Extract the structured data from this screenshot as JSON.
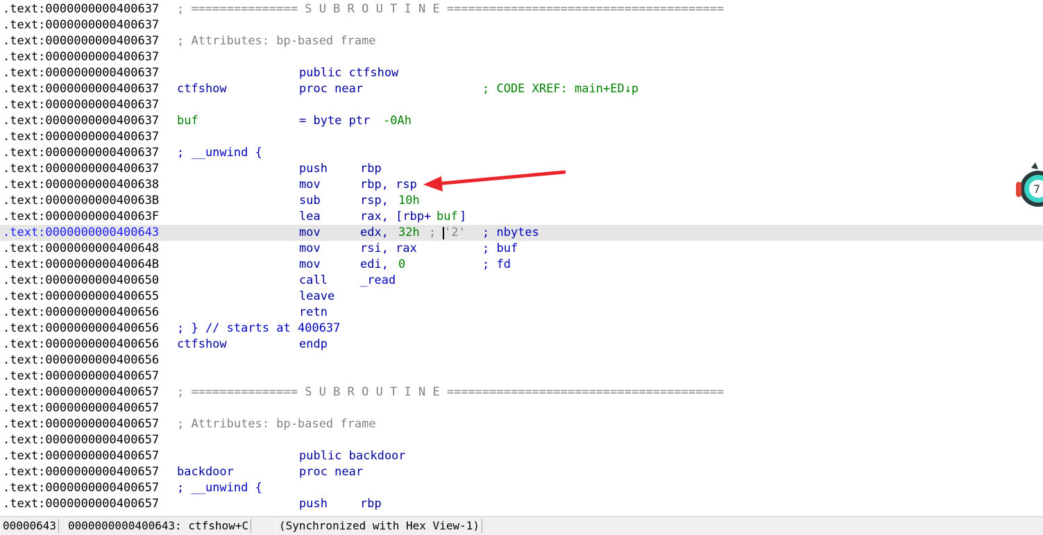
{
  "listing": {
    "lines": [
      {
        "addr": ".text:0000000000400637",
        "parts": [
          {
            "t": "; =============== S U B R O U T I N E =======================================",
            "c": "c-gray",
            "col": 255
          }
        ]
      },
      {
        "addr": ".text:0000000000400637",
        "parts": []
      },
      {
        "addr": ".text:0000000000400637",
        "parts": [
          {
            "t": "; Attributes: bp-based frame",
            "c": "c-gray",
            "col": 255
          }
        ]
      },
      {
        "addr": ".text:0000000000400637",
        "parts": []
      },
      {
        "addr": ".text:0000000000400637",
        "parts": [
          {
            "t": "public ctfshow",
            "c": "c-navy",
            "col": 431
          }
        ]
      },
      {
        "addr": ".text:0000000000400637",
        "parts": [
          {
            "t": "ctfshow",
            "c": "c-navy",
            "col": 255
          },
          {
            "t": "proc near",
            "c": "c-navy",
            "col": 431
          },
          {
            "t": "; CODE XREF: main+ED↓p",
            "c": "c-green",
            "col": 695
          }
        ]
      },
      {
        "addr": ".text:0000000000400637",
        "parts": []
      },
      {
        "addr": ".text:0000000000400637",
        "parts": [
          {
            "t": "buf",
            "c": "c-green",
            "col": 255
          },
          {
            "t": "= byte ptr ",
            "c": "c-navy",
            "col": 431
          },
          {
            "t": "-0Ah",
            "c": "c-green",
            "col": 552
          }
        ]
      },
      {
        "addr": ".text:0000000000400637",
        "parts": []
      },
      {
        "addr": ".text:0000000000400637",
        "parts": [
          {
            "t": "; __unwind {",
            "c": "c-blue",
            "col": 255
          }
        ]
      },
      {
        "addr": ".text:0000000000400637",
        "parts": [
          {
            "t": "push",
            "c": "c-navy",
            "col": 431
          },
          {
            "t": "rbp",
            "c": "c-navy",
            "col": 519
          }
        ]
      },
      {
        "addr": ".text:0000000000400638",
        "parts": [
          {
            "t": "mov",
            "c": "c-navy",
            "col": 431
          },
          {
            "t": "rbp, rsp",
            "c": "c-navy",
            "col": 519
          }
        ]
      },
      {
        "addr": ".text:000000000040063B",
        "parts": [
          {
            "t": "sub",
            "c": "c-navy",
            "col": 431
          },
          {
            "t": "rsp, ",
            "c": "c-navy",
            "col": 519
          },
          {
            "t": "10h",
            "c": "c-green",
            "col": 574
          }
        ]
      },
      {
        "addr": ".text:000000000040063F",
        "parts": [
          {
            "t": "lea",
            "c": "c-navy",
            "col": 431
          },
          {
            "t": "rax, [rbp+",
            "c": "c-navy",
            "col": 519
          },
          {
            "t": "buf",
            "c": "c-green",
            "col": 629
          },
          {
            "t": "]",
            "c": "c-navy",
            "col": 662
          }
        ]
      },
      {
        "addr": ".text:0000000000400643",
        "current": true,
        "parts": [
          {
            "t": "mov",
            "c": "c-navy",
            "col": 431
          },
          {
            "t": "edx, ",
            "c": "c-navy",
            "col": 519
          },
          {
            "t": "32h",
            "c": "c-green",
            "col": 574
          },
          {
            "t": "; ",
            "c": "c-gray",
            "col": 618
          },
          {
            "t": "'2'",
            "c": "c-gray",
            "col": 640
          },
          {
            "t": "; nbytes",
            "c": "c-blue",
            "col": 695
          }
        ]
      },
      {
        "addr": ".text:0000000000400648",
        "parts": [
          {
            "t": "mov",
            "c": "c-navy",
            "col": 431
          },
          {
            "t": "rsi, rax",
            "c": "c-navy",
            "col": 519
          },
          {
            "t": "; buf",
            "c": "c-blue",
            "col": 695
          }
        ]
      },
      {
        "addr": ".text:000000000040064B",
        "parts": [
          {
            "t": "mov",
            "c": "c-navy",
            "col": 431
          },
          {
            "t": "edi, ",
            "c": "c-navy",
            "col": 519
          },
          {
            "t": "0",
            "c": "c-green",
            "col": 574
          },
          {
            "t": "; fd",
            "c": "c-blue",
            "col": 695
          }
        ]
      },
      {
        "addr": ".text:0000000000400650",
        "parts": [
          {
            "t": "call",
            "c": "c-navy",
            "col": 431
          },
          {
            "t": "_read",
            "c": "c-blue",
            "col": 519
          }
        ]
      },
      {
        "addr": ".text:0000000000400655",
        "parts": [
          {
            "t": "leave",
            "c": "c-navy",
            "col": 431
          }
        ]
      },
      {
        "addr": ".text:0000000000400656",
        "parts": [
          {
            "t": "retn",
            "c": "c-navy",
            "col": 431
          }
        ]
      },
      {
        "addr": ".text:0000000000400656",
        "parts": [
          {
            "t": "; } // starts at 400637",
            "c": "c-blue",
            "col": 255
          }
        ]
      },
      {
        "addr": ".text:0000000000400656",
        "parts": [
          {
            "t": "ctfshow",
            "c": "c-navy",
            "col": 255
          },
          {
            "t": "endp",
            "c": "c-navy",
            "col": 431
          }
        ]
      },
      {
        "addr": ".text:0000000000400656",
        "parts": []
      },
      {
        "addr": ".text:0000000000400657",
        "parts": []
      },
      {
        "addr": ".text:0000000000400657",
        "parts": [
          {
            "t": "; =============== S U B R O U T I N E =======================================",
            "c": "c-gray",
            "col": 255
          }
        ]
      },
      {
        "addr": ".text:0000000000400657",
        "parts": []
      },
      {
        "addr": ".text:0000000000400657",
        "parts": [
          {
            "t": "; Attributes: bp-based frame",
            "c": "c-gray",
            "col": 255
          }
        ]
      },
      {
        "addr": ".text:0000000000400657",
        "parts": []
      },
      {
        "addr": ".text:0000000000400657",
        "parts": [
          {
            "t": "public backdoor",
            "c": "c-navy",
            "col": 431
          }
        ]
      },
      {
        "addr": ".text:0000000000400657",
        "parts": [
          {
            "t": "backdoor",
            "c": "c-navy",
            "col": 255
          },
          {
            "t": "proc near",
            "c": "c-navy",
            "col": 431
          }
        ]
      },
      {
        "addr": ".text:0000000000400657",
        "parts": [
          {
            "t": "; __unwind {",
            "c": "c-blue",
            "col": 255
          }
        ]
      },
      {
        "addr": ".text:0000000000400657",
        "parts": [
          {
            "t": "push",
            "c": "c-navy",
            "col": 431
          },
          {
            "t": "rbp",
            "c": "c-navy",
            "col": 519
          }
        ]
      }
    ]
  },
  "status": {
    "offset": "00000643",
    "location": "0000000000400643: ctfshow+C",
    "sync": "(Synchronized with Hex View-1)"
  },
  "colors": {
    "highlight_line": "#e6e6e6",
    "annotation_arrow": "#e8262b"
  }
}
